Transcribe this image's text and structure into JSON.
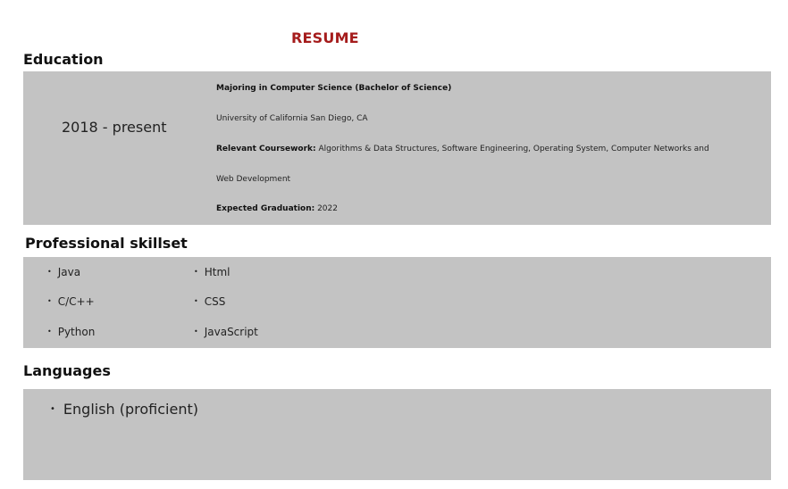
{
  "header": {
    "title": "RESUME"
  },
  "education": {
    "heading": "Education",
    "period": "2018 - present",
    "degree": "Majoring in Computer Science (Bachelor of Science)",
    "school": "University of California San Diego, CA",
    "coursework_label": "Relevant Coursework:",
    "coursework_text": " Algorithms & Data Structures, Software Engineering, Operating System, Computer Networks and",
    "coursework_cont": "Web Development",
    "graduation_label": "Expected Graduation:",
    "graduation_value": " 2022"
  },
  "skills": {
    "heading": "Professional skillset",
    "bullet": "•",
    "items": [
      "Java",
      "C/C++",
      "Python",
      "Html",
      "CSS",
      "JavaScript"
    ]
  },
  "languages": {
    "heading": "Languages",
    "bullet": "•",
    "items": [
      "English (proficient)"
    ]
  }
}
